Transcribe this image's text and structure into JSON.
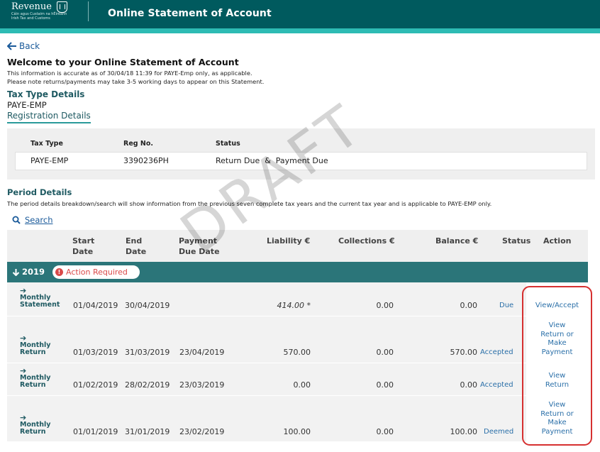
{
  "header": {
    "logo_main": "Revenue",
    "logo_sub1": "Cáin agus Custaim na hÉireann",
    "logo_sub2": "Irish Tax and Customs",
    "title": "Online Statement of Account"
  },
  "nav": {
    "back_label": "Back"
  },
  "welcome": {
    "title": "Welcome to your Online Statement of Account",
    "info_line1": "This information is accurate as of 30/04/18 11:39 for PAYE-Emp only, as applicable.",
    "info_line2": "Please note returns/payments may take 3-5 working days to appear on this Statement."
  },
  "tax_type": {
    "heading": "Tax Type Details",
    "value": "PAYE-EMP",
    "registration_link": "Registration Details"
  },
  "registration_table": {
    "headers": [
      "Tax Type",
      "Reg No.",
      "Status"
    ],
    "row": [
      "PAYE-EMP",
      "3390236PH",
      "Return Due  &  Payment Due"
    ]
  },
  "period": {
    "heading": "Period Details",
    "description": "The period details breakdown/search will show information from the previous seven complete tax years and the current tax year and is applicable to PAYE-EMP only.",
    "search_label": "Search"
  },
  "period_table": {
    "headers": {
      "start_1": "Start",
      "start_2": "Date",
      "end_1": "End",
      "end_2": "Date",
      "pay_1": "Payment",
      "pay_2": "Due Date",
      "liability": "Liability €",
      "collections": "Collections €",
      "balance": "Balance €",
      "status": "Status",
      "action": "Action"
    },
    "year": "2019",
    "action_required": "Action Required",
    "rows": [
      {
        "doc1": "Monthly",
        "doc2": "Statement",
        "start": "01/04/2019",
        "end": "30/04/2019",
        "due": "",
        "liability": "414.00 *",
        "collections": "0.00",
        "balance": "0.00",
        "status": "Due",
        "action1": "View/Accept",
        "action2": "",
        "action3": "",
        "action4": ""
      },
      {
        "doc1": "Monthly",
        "doc2": "Return",
        "start": "01/03/2019",
        "end": "31/03/2019",
        "due": "23/04/2019",
        "liability": "570.00",
        "collections": "0.00",
        "balance": "570.00",
        "status": "Accepted",
        "action1": "View",
        "action2": "Return or",
        "action3": "Make",
        "action4": "Payment"
      },
      {
        "doc1": "Monthly",
        "doc2": "Return",
        "start": "01/02/2019",
        "end": "28/02/2019",
        "due": "23/03/2019",
        "liability": "0.00",
        "collections": "0.00",
        "balance": "0.00",
        "status": "Accepted",
        "action1": "View",
        "action2": "Return",
        "action3": "",
        "action4": ""
      },
      {
        "doc1": "Monthly",
        "doc2": "Return",
        "start": "01/01/2019",
        "end": "31/01/2019",
        "due": "23/02/2019",
        "liability": "100.00",
        "collections": "0.00",
        "balance": "100.00",
        "status": "Deemed",
        "action1": "View",
        "action2": "Return or",
        "action3": "Make",
        "action4": "Payment"
      }
    ]
  },
  "watermark": "DRAFT",
  "colors": {
    "header": "#005a5e",
    "stripe": "#2dbbb4",
    "year_bar": "#2b7579",
    "link": "#2a6fa8",
    "alert": "#d94949",
    "highlight": "#d63030"
  }
}
